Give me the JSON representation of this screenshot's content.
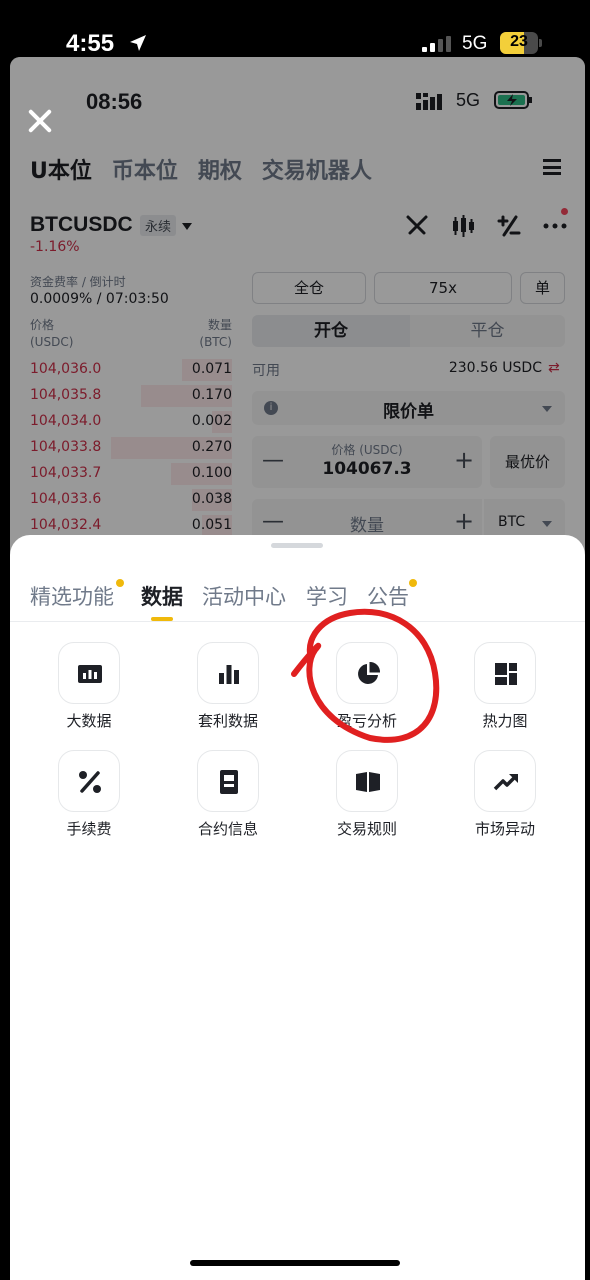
{
  "status_bar": {
    "time": "4:55",
    "network": "5G",
    "battery": "23"
  },
  "app": {
    "inner_time": "08:56",
    "inner_network": "5G",
    "top_tabs": [
      "U本位",
      "币本位",
      "期权",
      "交易机器人"
    ],
    "symbol": "BTCUSDC",
    "perp_badge": "永续",
    "change": "-1.16%",
    "funding_label": "资金费率 / 倒计时",
    "funding_value": "0.0009% / 07:03:50",
    "col_price": [
      "价格",
      "(USDC)"
    ],
    "col_qty": [
      "数量",
      "(BTC)"
    ],
    "orderbook": [
      {
        "price": "104,036.0",
        "qty": "0.071",
        "depth": 0.25
      },
      {
        "price": "104,035.8",
        "qty": "0.170",
        "depth": 0.45
      },
      {
        "price": "104,034.0",
        "qty": "0.002",
        "depth": 0.1
      },
      {
        "price": "104,033.8",
        "qty": "0.270",
        "depth": 0.6
      },
      {
        "price": "104,033.7",
        "qty": "0.100",
        "depth": 0.3
      },
      {
        "price": "104,033.6",
        "qty": "0.038",
        "depth": 0.2
      },
      {
        "price": "104,032.4",
        "qty": "0.051",
        "depth": 0.15
      }
    ],
    "margin_mode": "全仓",
    "leverage": "75x",
    "position_mode": "单",
    "open_tab": "开仓",
    "close_tab": "平仓",
    "available_label": "可用",
    "available_value": "230.56 USDC",
    "order_type": "限价单",
    "price_caption": "价格 (USDC)",
    "price_value": "104067.3",
    "best_price": "最优价",
    "qty_label": "数量",
    "qty_unit": "BTC"
  },
  "sheet": {
    "tabs": [
      {
        "label": "精选功能",
        "dot": true
      },
      {
        "label": "数据",
        "dot": false
      },
      {
        "label": "活动中心",
        "dot": false
      },
      {
        "label": "学习",
        "dot": false
      },
      {
        "label": "公告",
        "dot": true
      }
    ],
    "active_tab": "数据",
    "items": [
      {
        "label": "大数据",
        "icon": "big-data-icon"
      },
      {
        "label": "套利数据",
        "icon": "bar-chart-icon"
      },
      {
        "label": "盈亏分析",
        "icon": "pie-chart-icon"
      },
      {
        "label": "热力图",
        "icon": "heatmap-icon"
      },
      {
        "label": "手续费",
        "icon": "percent-icon"
      },
      {
        "label": "合约信息",
        "icon": "contract-info-icon"
      },
      {
        "label": "交易规则",
        "icon": "book-icon"
      },
      {
        "label": "市场异动",
        "icon": "trend-up-icon"
      }
    ]
  },
  "colors": {
    "accent": "#f0b90b",
    "sell": "#cf304a",
    "annotation": "#e02020"
  }
}
